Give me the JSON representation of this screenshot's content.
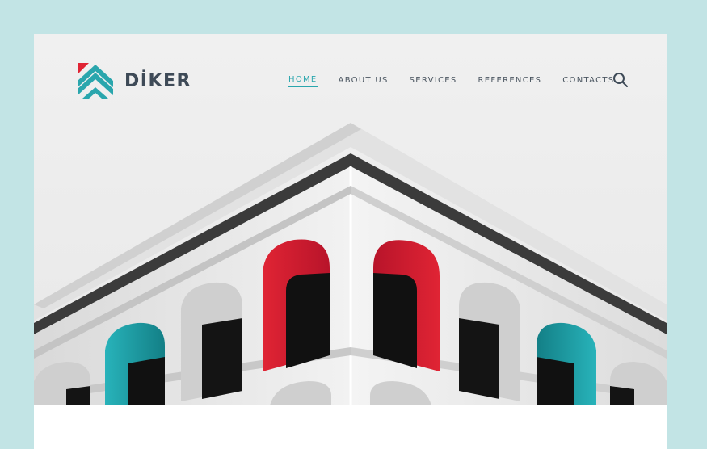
{
  "brand": {
    "name": "DİKER",
    "teal": "#2aa6ad",
    "red": "#e02434",
    "text_color": "#3e4a57"
  },
  "nav": {
    "items": [
      {
        "label": "HOME",
        "active": true
      },
      {
        "label": "ABOUT US",
        "active": false
      },
      {
        "label": "SERVICES",
        "active": false
      },
      {
        "label": "REFERENCES",
        "active": false
      },
      {
        "label": "CONTACTS",
        "active": false
      }
    ],
    "search_icon": "search-icon"
  },
  "hero": {
    "image": "white building corner facade with red and teal arched windows",
    "window_colors": {
      "red": "#c9172c",
      "teal": "#1d9ea5",
      "dark": "#121212"
    }
  },
  "page": {
    "background": "#c2e4e5",
    "card_background": "#eeeeee"
  }
}
